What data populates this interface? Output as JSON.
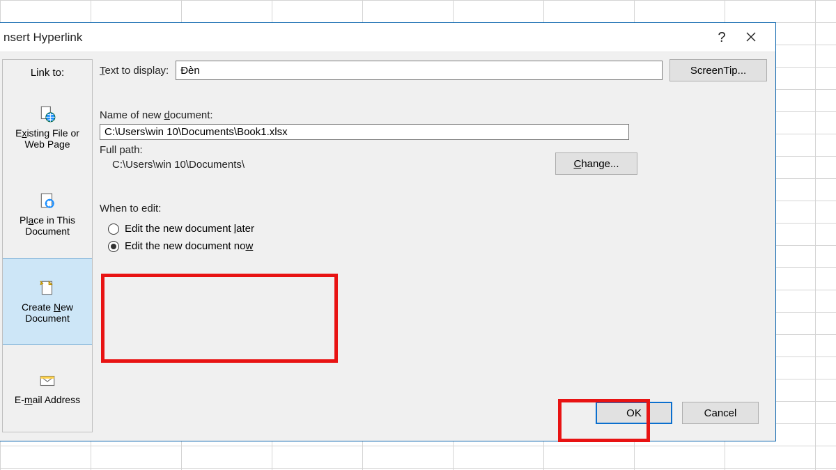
{
  "dialog": {
    "title": "nsert Hyperlink"
  },
  "sidebar": {
    "header": "Link to:",
    "items": [
      {
        "label_html": "E<u>x</u>isting File or Web Page"
      },
      {
        "label_html": "Pl<u>a</u>ce in This Document"
      },
      {
        "label_html": "Create <u>N</u>ew Document"
      },
      {
        "label_html": "E-<u>m</u>ail Address"
      }
    ]
  },
  "main": {
    "text_to_display_label_html": "<u>T</u>ext to display:",
    "text_to_display_value": "Đèn",
    "screentip_button": "ScreenTip...",
    "name_of_doc_label_html": "Name of new <u>d</u>ocument:",
    "name_of_doc_value": "C:\\Users\\win 10\\Documents\\Book1.xlsx",
    "full_path_label": "Full path:",
    "full_path_value": "C:\\Users\\win 10\\Documents\\",
    "change_button_html": "<u>C</u>hange...",
    "when_to_edit_label": "When to edit:",
    "radio_later_html": "Edit the new document <u>l</u>ater",
    "radio_now_html": "Edit the new document no<u>w</u>"
  },
  "footer": {
    "ok": "OK",
    "cancel": "Cancel"
  }
}
